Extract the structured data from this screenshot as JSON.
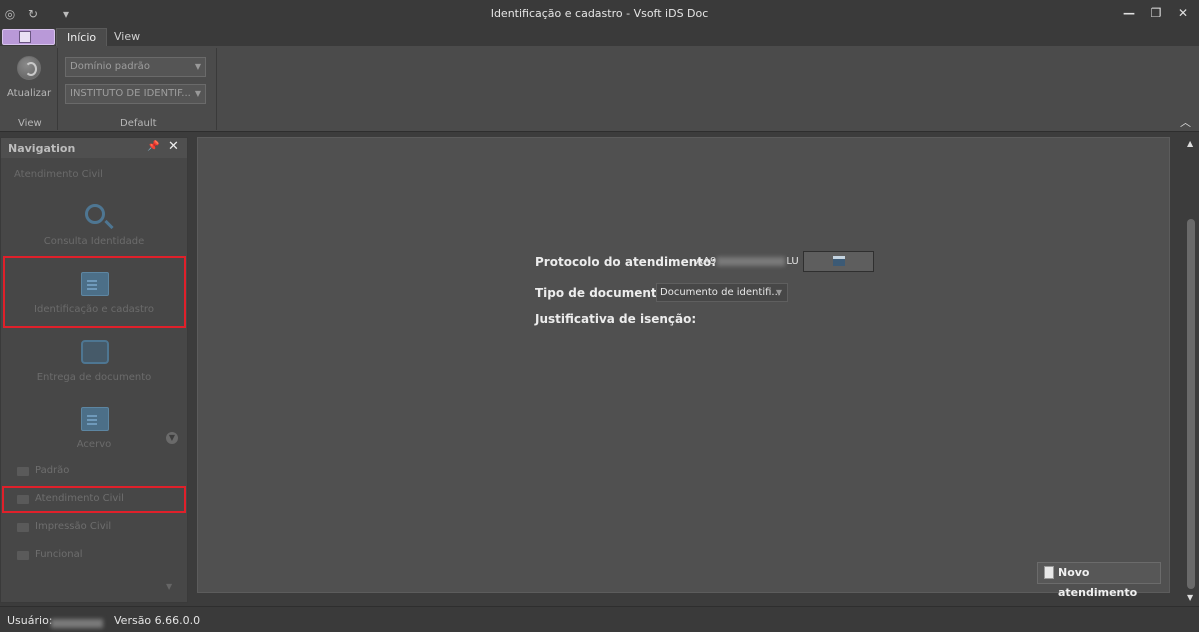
{
  "window": {
    "title": "Identificação e cadastro - Vsoft iDS Doc"
  },
  "ribbon": {
    "tabs": [
      "Início",
      "View"
    ],
    "refresh_label": "Atualizar",
    "group_view_label": "View",
    "group_default_label": "Default",
    "domain_combo": "Domínio padrão",
    "institution_combo": "INSTITUTO DE IDENTIF..."
  },
  "navigation": {
    "title": "Navigation",
    "group_title": "Atendimento Civil",
    "items": [
      {
        "label": "Consulta Identidade",
        "icon": "search-icon"
      },
      {
        "label": "Identificação e cadastro",
        "icon": "id-card-icon"
      },
      {
        "label": "Entrega de documento",
        "icon": "exchange-icon"
      },
      {
        "label": "Acervo",
        "icon": "archive-card-icon"
      }
    ],
    "folders": [
      "Padrão",
      "Atendimento Civil",
      "Impressão Civil",
      "Funcional"
    ],
    "highlight_color": "#e0202a"
  },
  "form": {
    "protocol_label": "Protocolo do atendimento:",
    "protocol_prefix": "AA9",
    "protocol_suffix": "LU",
    "doc_type_label": "Tipo de documento:",
    "doc_type_value": "Documento de identifi...",
    "justification_label": "Justificativa de isenção:",
    "new_button": "Novo atendimento"
  },
  "status": {
    "user_label": "Usuário:",
    "version": "Versão 6.66.0.0"
  }
}
